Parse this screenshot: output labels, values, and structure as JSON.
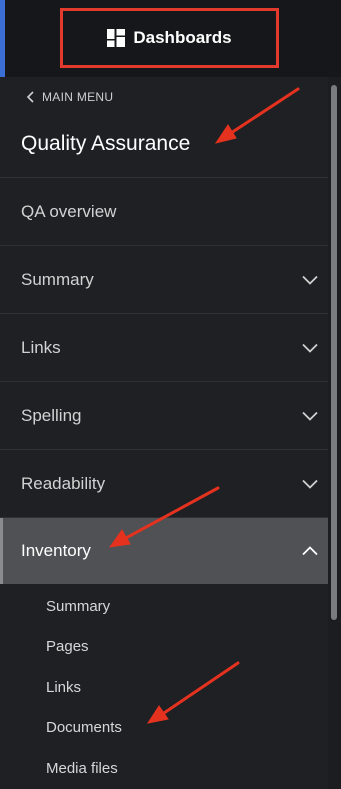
{
  "topbar": {
    "dashboards_label": "Dashboards",
    "highlight_color": "#e23b2e",
    "accent_color": "#3b6fd6"
  },
  "nav": {
    "back_label": "MAIN MENU",
    "section_title": "Quality Assurance",
    "items": [
      {
        "label": "QA overview",
        "expandable": false
      },
      {
        "label": "Summary",
        "expandable": true,
        "expanded": false
      },
      {
        "label": "Links",
        "expandable": true,
        "expanded": false
      },
      {
        "label": "Spelling",
        "expandable": true,
        "expanded": false
      },
      {
        "label": "Readability",
        "expandable": true,
        "expanded": false
      },
      {
        "label": "Inventory",
        "expandable": true,
        "expanded": true,
        "active": true
      }
    ],
    "inventory_subitems": [
      "Summary",
      "Pages",
      "Links",
      "Documents",
      "Media files"
    ]
  },
  "annotations": {
    "arrow_color": "#e5321f",
    "arrows": [
      "section-title",
      "inventory",
      "documents"
    ]
  }
}
